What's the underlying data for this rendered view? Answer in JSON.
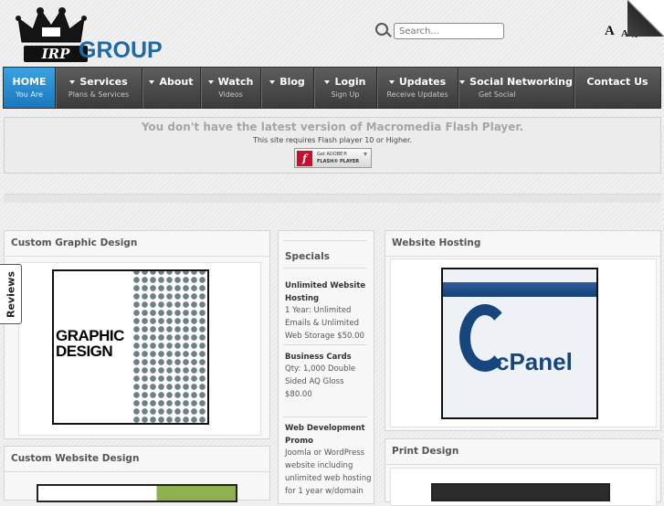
{
  "header": {
    "logo_text": "GROUP",
    "logo_badge": "IRP",
    "search_placeholder": "Search...",
    "font_increase": "A",
    "font_reset": "A",
    "font_decrease": "A"
  },
  "nav": [
    {
      "label": "HOME",
      "sub": "You Are",
      "caret": false
    },
    {
      "label": "Services",
      "sub": "Plans & Services",
      "caret": true
    },
    {
      "label": "About",
      "sub": "",
      "caret": true
    },
    {
      "label": "Watch",
      "sub": "Videos",
      "caret": true
    },
    {
      "label": "Blog",
      "sub": "",
      "caret": true
    },
    {
      "label": "Login",
      "sub": "Sign Up",
      "caret": true
    },
    {
      "label": "Updates",
      "sub": "Receive Updates",
      "caret": true
    },
    {
      "label": "Social Networking",
      "sub": "Get Social",
      "caret": true
    },
    {
      "label": "Contact Us",
      "sub": "",
      "caret": false
    }
  ],
  "flash": {
    "title": "You don't have the latest version of Macromedia Flash Player.",
    "subtitle": "This site requires Flash player 10 or Higher.",
    "badge_line1": "Get ADOBE®",
    "badge_line2": "FLASH® PLAYER"
  },
  "panels": {
    "graphic": {
      "title": "Custom Graphic Design",
      "image_text": "GRAPHIC DESIGN"
    },
    "website": {
      "title": "Custom Website Design"
    },
    "hosting": {
      "title": "Website Hosting",
      "image_text": "cPanel"
    },
    "print": {
      "title": "Print Design"
    }
  },
  "reviews_tab": "Reviews",
  "specials": {
    "heading": "Specials",
    "items": [
      {
        "title": "Unlimited Website Hosting",
        "body": "1 Year: Unlimited Emails & Unlimited Web Storage $50.00"
      },
      {
        "title": "Business Cards",
        "body": "Qty: 1,000 Double Sided AQ Gloss $80.00"
      },
      {
        "title": "Web Development Promo",
        "body": "Joomla or WordPress website including unlimited web hosting for 1 year w/domain"
      }
    ]
  }
}
